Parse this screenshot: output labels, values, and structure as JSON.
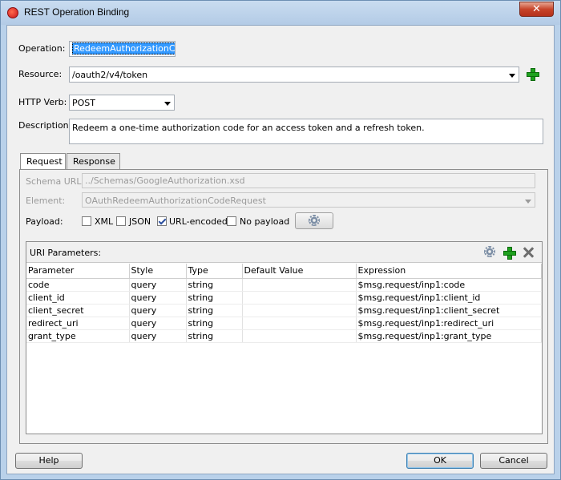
{
  "window": {
    "title": "REST Operation Binding",
    "close_label": "✕"
  },
  "form": {
    "operation_label": "Operation:",
    "operation_value": "RedeemAuthorizationCode",
    "resource_label": "Resource:",
    "resource_value": "/oauth2/v4/token",
    "verb_label": "HTTP Verb:",
    "verb_value": "POST",
    "description_label": "Description:",
    "description_value": "Redeem a one-time authorization code for an access token and a refresh token."
  },
  "tabs": [
    {
      "label": "Request",
      "active": true
    },
    {
      "label": "Response",
      "active": false
    }
  ],
  "request": {
    "schema_label": "Schema URL:",
    "schema_value": "../Schemas/GoogleAuthorization.xsd",
    "element_label": "Element:",
    "element_value": "OAuthRedeemAuthorizationCodeRequest",
    "payload_label": "Payload:",
    "payload_options": [
      {
        "label": "XML",
        "checked": false
      },
      {
        "label": "JSON",
        "checked": false
      },
      {
        "label": "URL-encoded",
        "checked": true
      },
      {
        "label": "No payload",
        "checked": false
      }
    ]
  },
  "uri": {
    "title": "URI Parameters:",
    "columns": [
      "Parameter",
      "Style",
      "Type",
      "Default Value",
      "Expression"
    ],
    "rows": [
      [
        "code",
        "query",
        "string",
        "",
        "$msg.request/inp1:code"
      ],
      [
        "client_id",
        "query",
        "string",
        "",
        "$msg.request/inp1:client_id"
      ],
      [
        "client_secret",
        "query",
        "string",
        "",
        "$msg.request/inp1:client_secret"
      ],
      [
        "redirect_uri",
        "query",
        "string",
        "",
        "$msg.request/inp1:redirect_uri"
      ],
      [
        "grant_type",
        "query",
        "string",
        "",
        "$msg.request/inp1:grant_type"
      ]
    ]
  },
  "buttons": {
    "help": "Help",
    "ok": "OK",
    "cancel": "Cancel"
  },
  "colors": {
    "titlebar": "#b9d1ea",
    "accent_green": "#1fa11f",
    "selection": "#3399ff"
  }
}
